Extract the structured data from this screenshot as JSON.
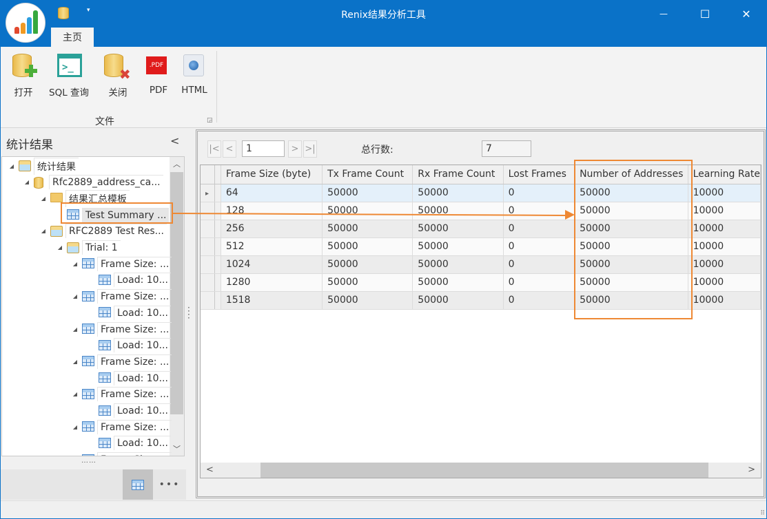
{
  "window": {
    "title": "Renix结果分析工具",
    "minimize_icon": "minimize-icon",
    "maximize_icon": "maximize-icon",
    "close_icon": "close-icon",
    "minimize_glyph": "—",
    "maximize_glyph": "☐",
    "close_glyph": "✕"
  },
  "quick_access": {
    "dropdown_glyph": "▾"
  },
  "ribbon": {
    "tabs": [
      {
        "label": "主页",
        "active": true
      }
    ],
    "groups": [
      {
        "label": "文件",
        "buttons": [
          {
            "label": "打开",
            "icon": "open-database-icon"
          },
          {
            "label": "SQL 查询",
            "icon": "terminal-icon"
          },
          {
            "label": "关闭",
            "icon": "close-database-icon"
          },
          {
            "label": "PDF",
            "icon": "pdf-icon",
            "icon_text": ".PDF"
          },
          {
            "label": "HTML",
            "icon": "html-globe-icon"
          }
        ]
      }
    ]
  },
  "left_pane": {
    "title": "统计结果",
    "collapse_glyph": "<",
    "tree": [
      {
        "label": "统计结果",
        "icon": "report-icon",
        "expanded": true,
        "level": 0
      },
      {
        "label": "Rfc2889_address_ca...",
        "icon": "database-icon",
        "expanded": true,
        "level": 1
      },
      {
        "label": "结果汇总模板",
        "icon": "folder-icon",
        "expanded": true,
        "level": 2
      },
      {
        "label": "Test Summary ...",
        "icon": "grid-icon",
        "level": 3,
        "selected": true
      },
      {
        "label": "RFC2889 Test Res...",
        "icon": "report-icon",
        "expanded": true,
        "level": 2
      },
      {
        "label": "Trial: 1",
        "icon": "report-icon",
        "expanded": true,
        "level": 3
      },
      {
        "label": "Frame Size: ...",
        "icon": "grid-icon",
        "expanded": true,
        "level": 4
      },
      {
        "label": "Load: 10...",
        "icon": "grid-icon",
        "level": 5
      },
      {
        "label": "Frame Size: ...",
        "icon": "grid-icon",
        "expanded": true,
        "level": 4
      },
      {
        "label": "Load: 10...",
        "icon": "grid-icon",
        "level": 5
      },
      {
        "label": "Frame Size: ...",
        "icon": "grid-icon",
        "expanded": true,
        "level": 4
      },
      {
        "label": "Load: 10...",
        "icon": "grid-icon",
        "level": 5
      },
      {
        "label": "Frame Size: ...",
        "icon": "grid-icon",
        "expanded": true,
        "level": 4
      },
      {
        "label": "Load: 10...",
        "icon": "grid-icon",
        "level": 5
      },
      {
        "label": "Frame Size: ...",
        "icon": "grid-icon",
        "expanded": true,
        "level": 4
      },
      {
        "label": "Load: 10...",
        "icon": "grid-icon",
        "level": 5
      },
      {
        "label": "Frame Size: ...",
        "icon": "grid-icon",
        "expanded": true,
        "level": 4
      },
      {
        "label": "Load: 10...",
        "icon": "grid-icon",
        "level": 5
      },
      {
        "label": "Frame Size: ...",
        "icon": "grid-icon",
        "expanded": true,
        "level": 4
      }
    ],
    "splitter_glyph": "……",
    "footer": {
      "more_glyph": "•••"
    }
  },
  "pager": {
    "first_glyph": "|<",
    "prev_glyph": "<",
    "page": "1",
    "next_glyph": ">",
    "last_glyph": ">|",
    "total_label": "总行数:",
    "total_value": "7"
  },
  "grid": {
    "columns": [
      "Frame Size (byte)",
      "Tx Frame Count",
      "Rx Frame Count",
      "Lost Frames",
      "Number of Addresses",
      "Learning Rate"
    ],
    "rows": [
      [
        "64",
        "50000",
        "50000",
        "0",
        "50000",
        "10000"
      ],
      [
        "128",
        "50000",
        "50000",
        "0",
        "50000",
        "10000"
      ],
      [
        "256",
        "50000",
        "50000",
        "0",
        "50000",
        "10000"
      ],
      [
        "512",
        "50000",
        "50000",
        "0",
        "50000",
        "10000"
      ],
      [
        "1024",
        "50000",
        "50000",
        "0",
        "50000",
        "10000"
      ],
      [
        "1280",
        "50000",
        "50000",
        "0",
        "50000",
        "10000"
      ],
      [
        "1518",
        "50000",
        "50000",
        "0",
        "50000",
        "10000"
      ]
    ],
    "focused_row": 0,
    "row_indicator_glyph": "▸",
    "hscroll_left_glyph": "<",
    "hscroll_right_glyph": ">"
  },
  "annotation": {
    "color": "#ee8833",
    "target_column": "Number of Addresses"
  },
  "colors": {
    "titlebar": "#0a72c8",
    "accent": "#ee8833"
  }
}
